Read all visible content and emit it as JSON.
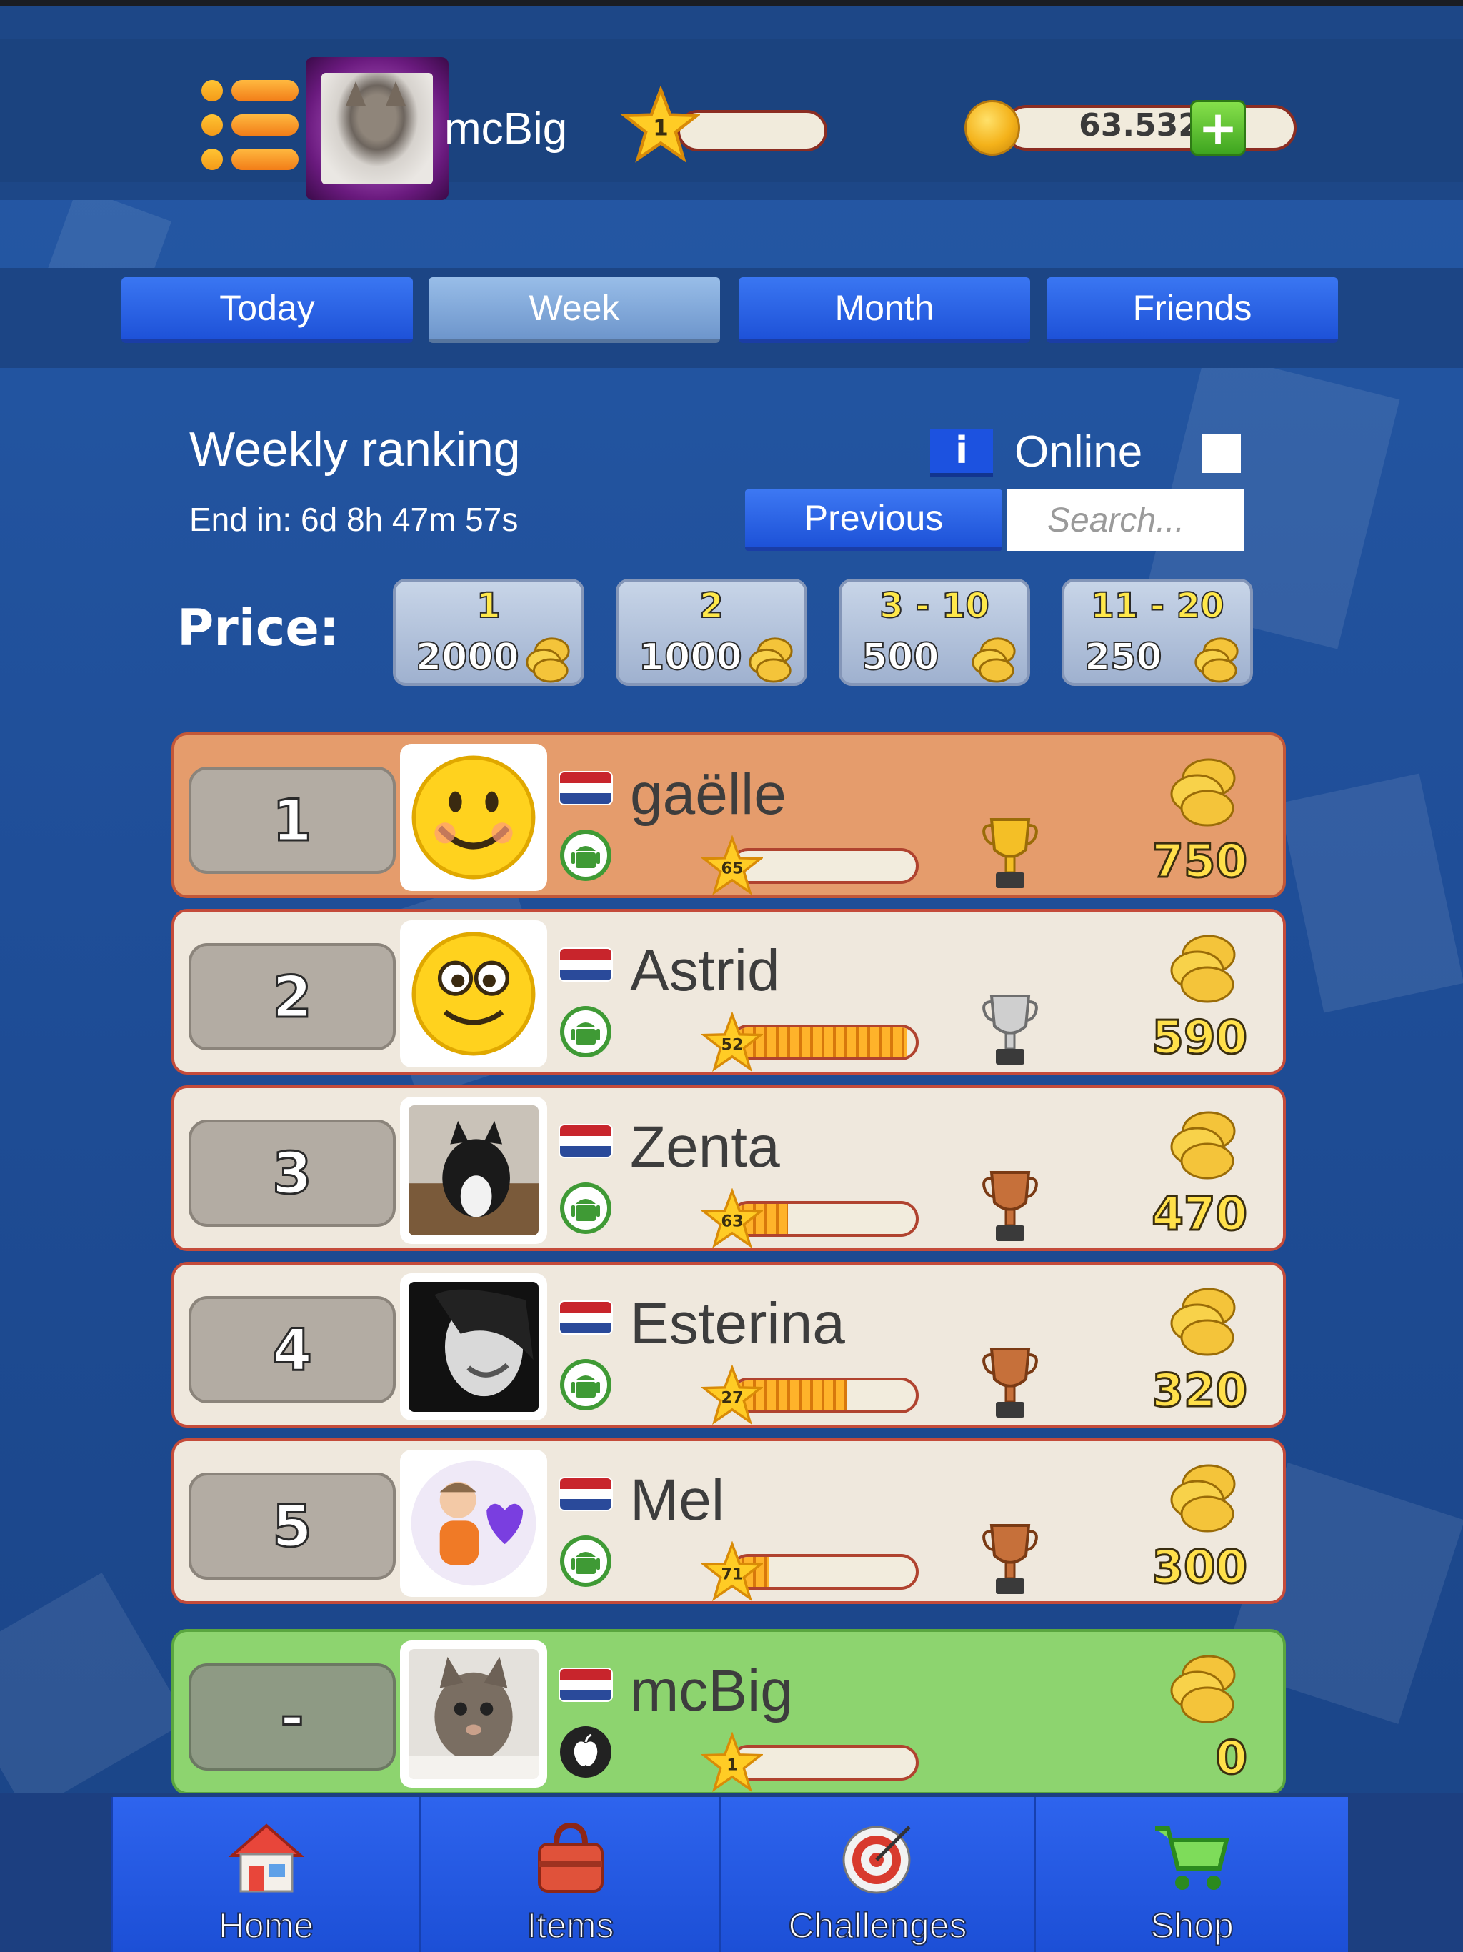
{
  "header": {
    "username": "mcBig",
    "level": "1",
    "coins": "63.532",
    "add_coins_label": "+"
  },
  "tabs": [
    {
      "label": "Today",
      "active": false
    },
    {
      "label": "Week",
      "active": true
    },
    {
      "label": "Month",
      "active": false
    },
    {
      "label": "Friends",
      "active": false
    }
  ],
  "ranking": {
    "title": "Weekly ranking",
    "end_in": "End in: 6d 8h 47m 57s",
    "info_label": "i",
    "online_label": "Online",
    "previous_label": "Previous",
    "search_placeholder": "Search..."
  },
  "prices": {
    "label": "Price:",
    "items": [
      {
        "place": "1",
        "amount": "2000"
      },
      {
        "place": "2",
        "amount": "1000"
      },
      {
        "place": "3 - 10",
        "amount": "500"
      },
      {
        "place": "11 - 20",
        "amount": "250"
      }
    ]
  },
  "rows": [
    {
      "rank": "1",
      "name": "gaëlle",
      "level": "65",
      "level_progress": 0.0,
      "prize": "750",
      "trophy": "gold-trophy",
      "os": "android",
      "flag": "netherlands"
    },
    {
      "rank": "2",
      "name": "Astrid",
      "level": "52",
      "level_progress": 0.95,
      "prize": "590",
      "trophy": "silver-trophy",
      "os": "android",
      "flag": "netherlands"
    },
    {
      "rank": "3",
      "name": "Zenta",
      "level": "63",
      "level_progress": 0.3,
      "prize": "470",
      "trophy": "bronze-trophy",
      "os": "android",
      "flag": "netherlands"
    },
    {
      "rank": "4",
      "name": "Esterina",
      "level": "27",
      "level_progress": 0.62,
      "prize": "320",
      "trophy": "bronze-trophy",
      "os": "android",
      "flag": "netherlands"
    },
    {
      "rank": "5",
      "name": "Mel",
      "level": "71",
      "level_progress": 0.2,
      "prize": "300",
      "trophy": "bronze-trophy",
      "os": "android",
      "flag": "netherlands"
    }
  ],
  "self_row": {
    "rank": "-",
    "name": "mcBig",
    "level": "1",
    "level_progress": 0.0,
    "prize": "0",
    "os": "apple",
    "flag": "netherlands"
  },
  "nav": [
    {
      "label": "Home",
      "icon": "house-icon"
    },
    {
      "label": "Items",
      "icon": "bag-icon"
    },
    {
      "label": "Challenges",
      "icon": "target-icon"
    },
    {
      "label": "Shop",
      "icon": "cart-icon"
    }
  ],
  "colors": {
    "background": "#1f4f98",
    "tab": "#2e64ee",
    "tab_active": "#8db2e2",
    "row": "#efe8dd",
    "row_first": "#e59c6c",
    "row_self": "#8dd46f",
    "prize_text": "#ffe04a"
  }
}
